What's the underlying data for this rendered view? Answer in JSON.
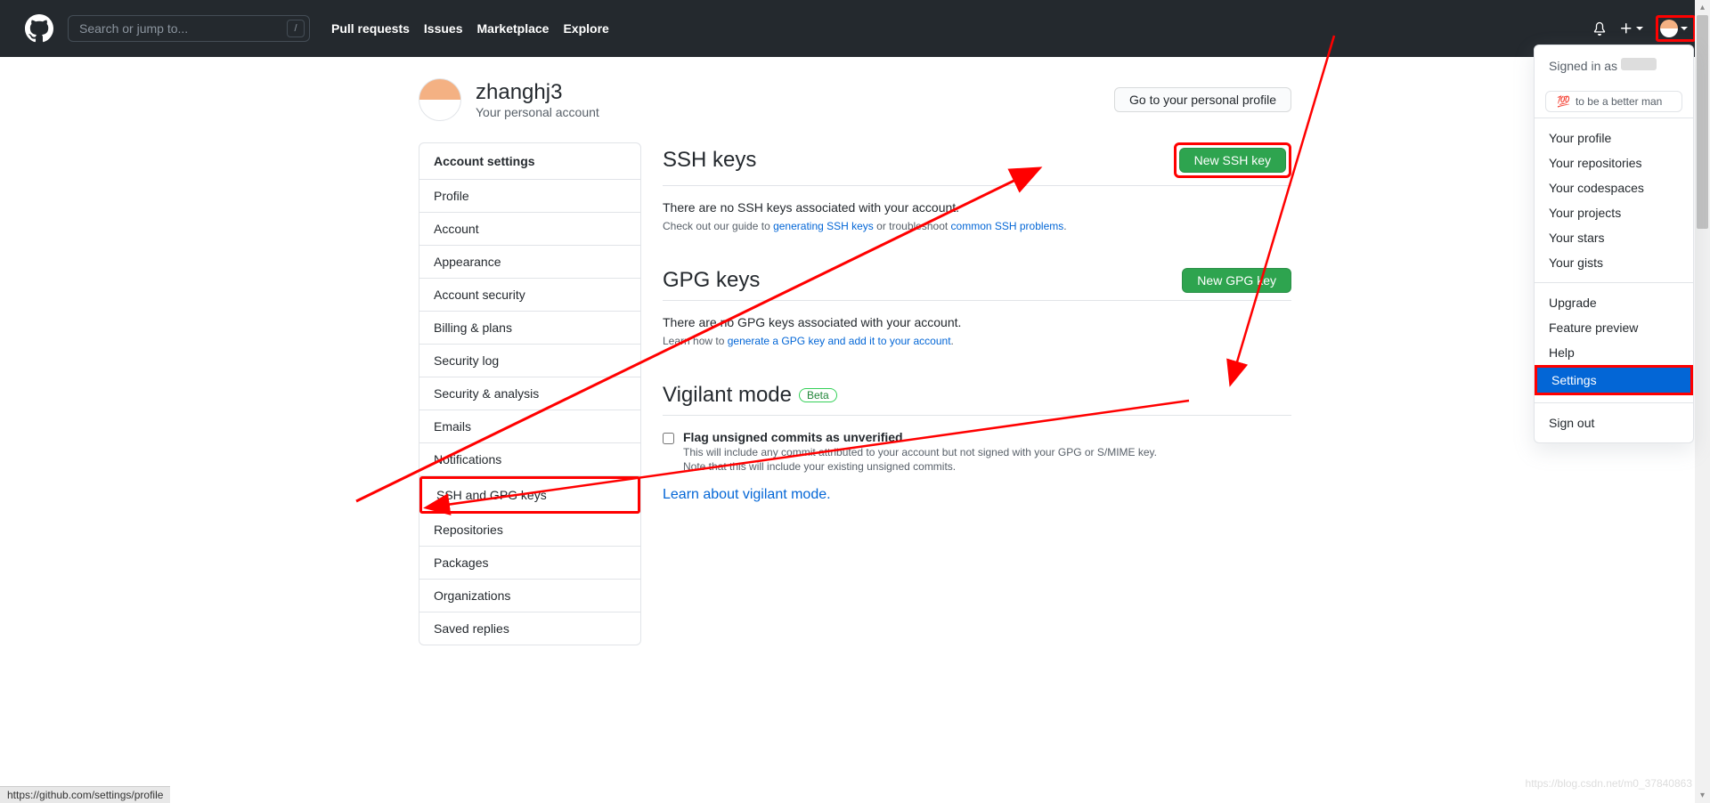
{
  "topnav": {
    "search_placeholder": "Search or jump to...",
    "slash": "/",
    "links": {
      "pulls": "Pull requests",
      "issues": "Issues",
      "marketplace": "Marketplace",
      "explore": "Explore"
    }
  },
  "profile": {
    "username": "zhanghj3",
    "subtext": "Your personal account",
    "goto_profile_btn": "Go to your personal profile"
  },
  "sidebar": {
    "header": "Account settings",
    "items": [
      "Profile",
      "Account",
      "Appearance",
      "Account security",
      "Billing & plans",
      "Security log",
      "Security & analysis",
      "Emails",
      "Notifications",
      "SSH and GPG keys",
      "Repositories",
      "Packages",
      "Organizations",
      "Saved replies"
    ],
    "selected_index": 9
  },
  "ssh": {
    "title": "SSH keys",
    "new_btn": "New SSH key",
    "empty": "There are no SSH keys associated with your account.",
    "guide_prefix": "Check out our guide to ",
    "guide_link": "generating SSH keys",
    "guide_suffix_prefix": " or troubleshoot ",
    "guide_link2": "common SSH problems",
    "guide_suffix": "."
  },
  "gpg": {
    "title": "GPG keys",
    "new_btn": "New GPG key",
    "empty": "There are no GPG keys associated with your account.",
    "learn_prefix": "Learn how to ",
    "learn_link": "generate a GPG key and add it to your account",
    "learn_suffix": "."
  },
  "vigilant": {
    "title": "Vigilant mode",
    "badge": "Beta",
    "checkbox_label": "Flag unsigned commits as unverified",
    "desc1": "This will include any commit attributed to your account but not signed with your GPG or S/MIME key.",
    "desc2": "Note that this will include your existing unsigned commits.",
    "learn_link": "Learn about vigilant mode."
  },
  "dropdown": {
    "signed_in_as": "Signed in as",
    "status_emoji": "💯",
    "status_text": "to be a better man",
    "items_a": [
      "Your profile",
      "Your repositories",
      "Your codespaces",
      "Your projects",
      "Your stars",
      "Your gists"
    ],
    "items_b": [
      "Upgrade",
      "Feature preview",
      "Help",
      "Settings"
    ],
    "items_c": [
      "Sign out"
    ],
    "active": "Settings"
  },
  "statusbar": "https://github.com/settings/profile",
  "watermark": "https://blog.csdn.net/m0_37840863"
}
